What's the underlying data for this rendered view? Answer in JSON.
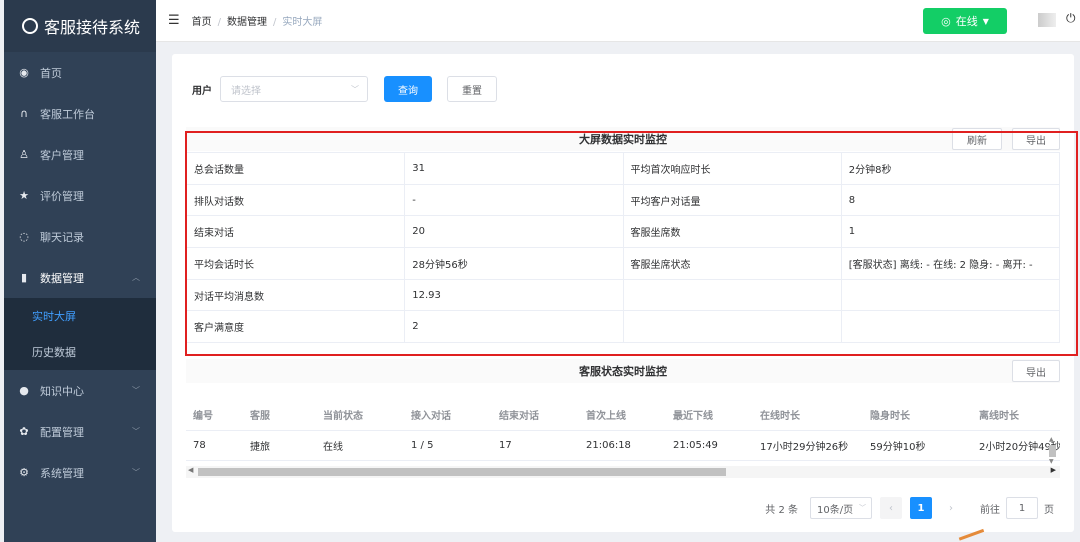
{
  "app": {
    "title": "客服接待系统"
  },
  "sidebar": {
    "items": [
      {
        "label": "首页",
        "icon": "dashboard-icon"
      },
      {
        "label": "客服工作台",
        "icon": "headset-icon"
      },
      {
        "label": "客户管理",
        "icon": "user-icon"
      },
      {
        "label": "评价管理",
        "icon": "star-icon"
      },
      {
        "label": "聊天记录",
        "icon": "chat-icon"
      },
      {
        "label": "数据管理",
        "icon": "bar-chart-icon"
      },
      {
        "label": "知识中心",
        "icon": "knowledge-icon"
      },
      {
        "label": "配置管理",
        "icon": "gear-icon"
      },
      {
        "label": "系统管理",
        "icon": "settings-icon"
      }
    ],
    "sub_items": [
      {
        "label": "实时大屏",
        "active": true
      },
      {
        "label": "历史数据",
        "active": false
      }
    ]
  },
  "header": {
    "breadcrumb": [
      "首页",
      "数据管理",
      "实时大屏"
    ],
    "status_label": "在线"
  },
  "filter": {
    "user_label": "用户",
    "user_placeholder": "请选择",
    "query_button": "查询",
    "reset_button": "重置"
  },
  "monitor": {
    "title": "大屏数据实时监控",
    "refresh_button": "刷新",
    "export_button": "导出",
    "rows": [
      [
        "总会话数量",
        "31",
        "平均首次响应时长",
        "2分钟8秒"
      ],
      [
        "排队对话数",
        "-",
        "平均客户对话量",
        "8"
      ],
      [
        "结束对话",
        "20",
        "客服坐席数",
        "1"
      ],
      [
        "平均会话时长",
        "28分钟56秒",
        "客服坐席状态",
        "[客服状态] 离线: - 在线: 2 隐身: - 离开: -"
      ],
      [
        "对话平均消息数",
        "12.93",
        "",
        ""
      ],
      [
        "客户满意度",
        "2",
        "",
        ""
      ]
    ]
  },
  "agent_status": {
    "title": "客服状态实时监控",
    "export_button": "导出",
    "columns": [
      "编号",
      "客服",
      "当前状态",
      "接入对话",
      "结束对话",
      "首次上线",
      "最近下线",
      "在线时长",
      "隐身时长",
      "离线时长"
    ],
    "rows": [
      [
        "78",
        "捷旅",
        "在线",
        "1 / 5",
        "17",
        "21:06:18",
        "21:05:49",
        "17小时29分钟26秒",
        "59分钟10秒",
        "2小时20分钟49秒"
      ]
    ]
  },
  "pagination": {
    "total": "共 2 条",
    "page_size": "10条/页",
    "current": "1",
    "goto_prefix": "前往",
    "goto_value": "1",
    "goto_suffix": "页"
  },
  "colors": {
    "sidebar": "#304156",
    "primary": "#1890ff",
    "online": "#13ce66",
    "highlight": "#e02020"
  }
}
